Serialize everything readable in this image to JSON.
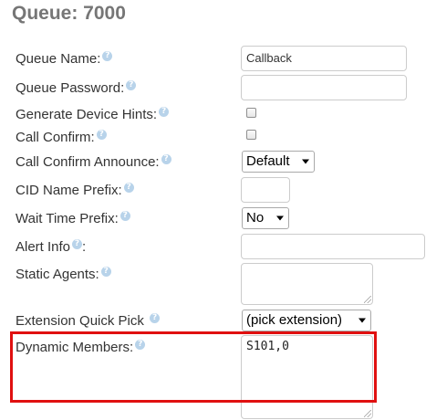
{
  "title": "Queue: 7000",
  "fields": {
    "queue_name": {
      "label": "Queue Name:",
      "value": "Callback"
    },
    "queue_password": {
      "label": "Queue Password:",
      "value": ""
    },
    "generate_device_hints": {
      "label": "Generate Device Hints:"
    },
    "call_confirm": {
      "label": "Call Confirm:"
    },
    "call_confirm_announce": {
      "label": "Call Confirm Announce:",
      "selected": "Default"
    },
    "cid_name_prefix": {
      "label": "CID Name Prefix:",
      "value": ""
    },
    "wait_time_prefix": {
      "label": "Wait Time Prefix:",
      "selected": "No"
    },
    "alert_info": {
      "label": "Alert Info",
      "suffix": ":",
      "value": ""
    },
    "static_agents": {
      "label": "Static Agents:",
      "value": ""
    },
    "extension_quick_pick": {
      "label": "Extension Quick Pick",
      "selected": "(pick extension)"
    },
    "dynamic_members": {
      "label": "Dynamic Members:",
      "value": "S101,0"
    }
  },
  "help_glyph": "?",
  "colors": {
    "title": "#767676",
    "help_icon": "#b8d3ea",
    "highlight_box": "#e01010"
  }
}
